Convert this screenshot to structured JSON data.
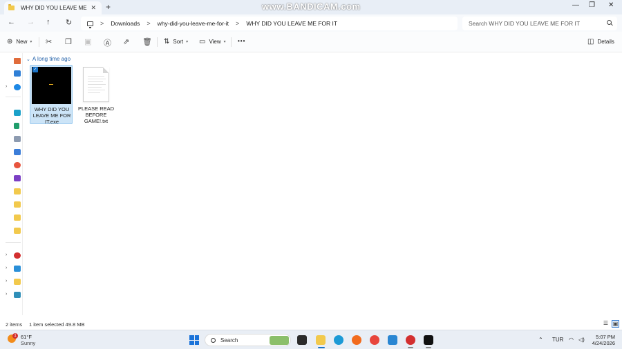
{
  "watermark": "www.BANDICAM.com",
  "tab": {
    "title": "WHY DID YOU LEAVE ME FOR",
    "close": "✕",
    "new_tab": "+"
  },
  "window_controls": {
    "minimize": "—",
    "maximize": "❐",
    "close": "✕"
  },
  "breadcrumb": {
    "items": [
      "Downloads",
      "why-did-you-leave-me-for-it",
      "WHY DID YOU LEAVE ME FOR IT"
    ],
    "separator": ">"
  },
  "search": {
    "placeholder": "Search WHY DID YOU LEAVE ME FOR IT"
  },
  "toolbar": {
    "new_label": "New",
    "sort_label": "Sort",
    "view_label": "View",
    "more_label": "•••",
    "details_label": "Details"
  },
  "group": {
    "label": "A long time ago"
  },
  "files": [
    {
      "name": "WHY DID YOU LEAVE ME FOR IT.exe",
      "selected": true,
      "type": "exe"
    },
    {
      "name": "PLEASE READ BEFORE GAME!.txt",
      "selected": false,
      "type": "txt"
    }
  ],
  "status": {
    "count": "2 items",
    "selection": "1 item selected  49.8 MB"
  },
  "taskbar": {
    "weather_temp": "61°F",
    "weather_cond": "Sunny",
    "weather_badge": "1",
    "search_label": "Search",
    "language": "TUR",
    "time": "5:07 PM",
    "date": "4/24/2026"
  },
  "colors": {
    "accent": "#1a73c7",
    "selection_bg": "#cce4f7",
    "titlebar_bg": "#e8eef6",
    "taskbar_bg": "#e9eef5",
    "folder": "#f2c94c"
  }
}
